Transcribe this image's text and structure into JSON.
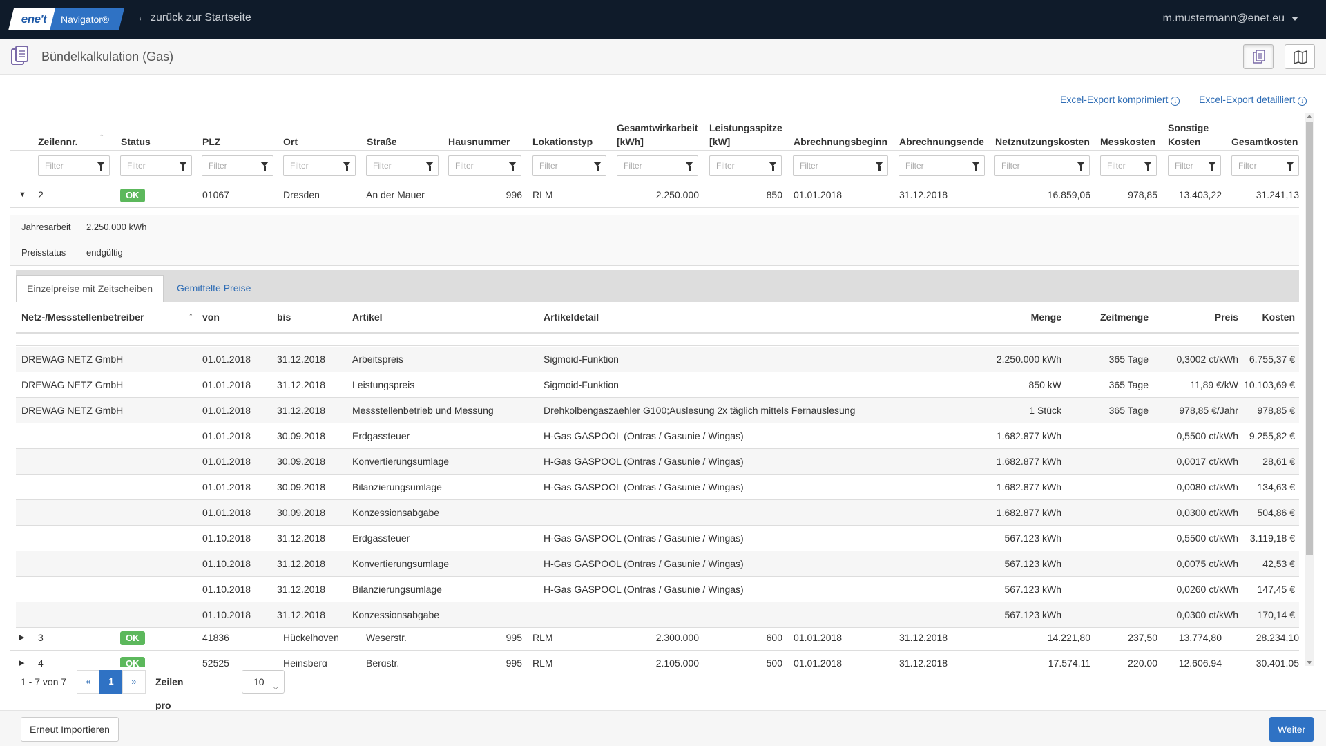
{
  "navbar": {
    "logo": "ene't",
    "product": "Navigator®",
    "back_link": "zurück zur Startseite",
    "user": "m.mustermann@enet.eu"
  },
  "page": {
    "title": "Bündelkalkulation (Gas)"
  },
  "exports": {
    "compressed": "Excel-Export komprimiert",
    "detailed": "Excel-Export detailliert"
  },
  "grid": {
    "columns": [
      {
        "line1": "",
        "line2": "Zeilennr."
      },
      {
        "line1": "",
        "line2": "Status"
      },
      {
        "line1": "",
        "line2": "PLZ"
      },
      {
        "line1": "",
        "line2": "Ort"
      },
      {
        "line1": "",
        "line2": "Straße"
      },
      {
        "line1": "",
        "line2": "Hausnummer"
      },
      {
        "line1": "",
        "line2": "Lokationstyp"
      },
      {
        "line1": "Gesamtwirkarbeit",
        "line2": "[kWh]"
      },
      {
        "line1": "Leistungsspitze",
        "line2": "[kW]"
      },
      {
        "line1": "",
        "line2": "Abrechnungsbeginn"
      },
      {
        "line1": "",
        "line2": "Abrechnungsende"
      },
      {
        "line1": "",
        "line2": "Netznutzungskosten"
      },
      {
        "line1": "",
        "line2": "Messkosten"
      },
      {
        "line1": "Sonstige",
        "line2": "Kosten"
      },
      {
        "line1": "",
        "line2": "Gesamtkosten"
      }
    ],
    "filter_placeholder": "Filter",
    "rows": [
      {
        "nr": "2",
        "status": "OK",
        "plz": "01067",
        "ort": "Dresden",
        "strasse": "An der Mauer",
        "hausnr": "996",
        "typ": "RLM",
        "arbeit": "2.250.000",
        "leistung": "850",
        "beginn": "01.01.2018",
        "ende": "31.12.2018",
        "netz": "16.859,06",
        "mess": "978,85",
        "sonstige": "13.403,22",
        "gesamt": "31.241,13"
      },
      {
        "nr": "3",
        "status": "OK",
        "plz": "41836",
        "ort": "Hückelhoven",
        "strasse": "Weserstr.",
        "hausnr": "995",
        "typ": "RLM",
        "arbeit": "2.300.000",
        "leistung": "600",
        "beginn": "01.01.2018",
        "ende": "31.12.2018",
        "netz": "14.221,80",
        "mess": "237,50",
        "sonstige": "13.774,80",
        "gesamt": "28.234,10"
      },
      {
        "nr": "4",
        "status": "OK",
        "plz": "52525",
        "ort": "Heinsberg",
        "strasse": "Bergstr.",
        "hausnr": "995",
        "typ": "RLM",
        "arbeit": "2.105.000",
        "leistung": "500",
        "beginn": "01.01.2018",
        "ende": "31.12.2018",
        "netz": "17.574,11",
        "mess": "220,00",
        "sonstige": "12.606,94",
        "gesamt": "30.401,05"
      }
    ]
  },
  "detail": {
    "jahresarbeit_label": "Jahresarbeit",
    "jahresarbeit_value": "2.250.000 kWh",
    "preisstatus_label": "Preisstatus",
    "preisstatus_value": "endgültig",
    "tabs": [
      "Einzelpreise mit Zeitscheiben",
      "Gemittelte Preise"
    ],
    "columns": [
      "Netz-/Messstellenbetreiber",
      "von",
      "bis",
      "Artikel",
      "Artikeldetail",
      "Menge",
      "Zeitmenge",
      "Preis",
      "Kosten"
    ],
    "rows": [
      {
        "betreiber": "DREWAG NETZ GmbH",
        "von": "01.01.2018",
        "bis": "31.12.2018",
        "artikel": "Arbeitspreis",
        "detail": "Sigmoid-Funktion",
        "menge": "2.250.000 kWh",
        "zeit": "365 Tage",
        "preis": "0,3002 ct/kWh",
        "kosten": "6.755,37 €"
      },
      {
        "betreiber": "DREWAG NETZ GmbH",
        "von": "01.01.2018",
        "bis": "31.12.2018",
        "artikel": "Leistungspreis",
        "detail": "Sigmoid-Funktion",
        "menge": "850 kW",
        "zeit": "365 Tage",
        "preis": "11,89 €/kW",
        "kosten": "10.103,69 €"
      },
      {
        "betreiber": "DREWAG NETZ GmbH",
        "von": "01.01.2018",
        "bis": "31.12.2018",
        "artikel": "Messstellenbetrieb und Messung",
        "detail": "Drehkolbengaszaehler G100;Auslesung 2x täglich mittels Fernauslesung",
        "menge": "1 Stück",
        "zeit": "365 Tage",
        "preis": "978,85 €/Jahr",
        "kosten": "978,85 €"
      },
      {
        "betreiber": "",
        "von": "01.01.2018",
        "bis": "30.09.2018",
        "artikel": "Erdgassteuer",
        "detail": "H-Gas GASPOOL (Ontras / Gasunie / Wingas)",
        "menge": "1.682.877 kWh",
        "zeit": "",
        "preis": "0,5500 ct/kWh",
        "kosten": "9.255,82 €"
      },
      {
        "betreiber": "",
        "von": "01.01.2018",
        "bis": "30.09.2018",
        "artikel": "Konvertierungsumlage",
        "detail": "H-Gas GASPOOL (Ontras / Gasunie / Wingas)",
        "menge": "1.682.877 kWh",
        "zeit": "",
        "preis": "0,0017 ct/kWh",
        "kosten": "28,61 €"
      },
      {
        "betreiber": "",
        "von": "01.01.2018",
        "bis": "30.09.2018",
        "artikel": "Bilanzierungsumlage",
        "detail": "H-Gas GASPOOL (Ontras / Gasunie / Wingas)",
        "menge": "1.682.877 kWh",
        "zeit": "",
        "preis": "0,0080 ct/kWh",
        "kosten": "134,63 €"
      },
      {
        "betreiber": "",
        "von": "01.01.2018",
        "bis": "30.09.2018",
        "artikel": "Konzessionsabgabe",
        "detail": "",
        "menge": "1.682.877 kWh",
        "zeit": "",
        "preis": "0,0300 ct/kWh",
        "kosten": "504,86 €"
      },
      {
        "betreiber": "",
        "von": "01.10.2018",
        "bis": "31.12.2018",
        "artikel": "Erdgassteuer",
        "detail": "H-Gas GASPOOL (Ontras / Gasunie / Wingas)",
        "menge": "567.123 kWh",
        "zeit": "",
        "preis": "0,5500 ct/kWh",
        "kosten": "3.119,18 €"
      },
      {
        "betreiber": "",
        "von": "01.10.2018",
        "bis": "31.12.2018",
        "artikel": "Konvertierungsumlage",
        "detail": "H-Gas GASPOOL (Ontras / Gasunie / Wingas)",
        "menge": "567.123 kWh",
        "zeit": "",
        "preis": "0,0075 ct/kWh",
        "kosten": "42,53 €"
      },
      {
        "betreiber": "",
        "von": "01.10.2018",
        "bis": "31.12.2018",
        "artikel": "Bilanzierungsumlage",
        "detail": "H-Gas GASPOOL (Ontras / Gasunie / Wingas)",
        "menge": "567.123 kWh",
        "zeit": "",
        "preis": "0,0260 ct/kWh",
        "kosten": "147,45 €"
      },
      {
        "betreiber": "",
        "von": "01.10.2018",
        "bis": "31.12.2018",
        "artikel": "Konzessionsabgabe",
        "detail": "",
        "menge": "567.123 kWh",
        "zeit": "",
        "preis": "0,0300 ct/kWh",
        "kosten": "170,14 €"
      }
    ]
  },
  "pagination": {
    "count": "1 - 7 von 7",
    "prev": "«",
    "current": "1",
    "next": "»",
    "rows_label": "Zeilen pro Seite:",
    "rows_value": "10"
  },
  "footer": {
    "reimport": "Erneut Importieren",
    "next": "Weiter"
  },
  "colors": {
    "navbar": "#0f1b2a",
    "accent": "#2f72c4",
    "ok": "#5cb85c",
    "link": "#2f6db5"
  }
}
